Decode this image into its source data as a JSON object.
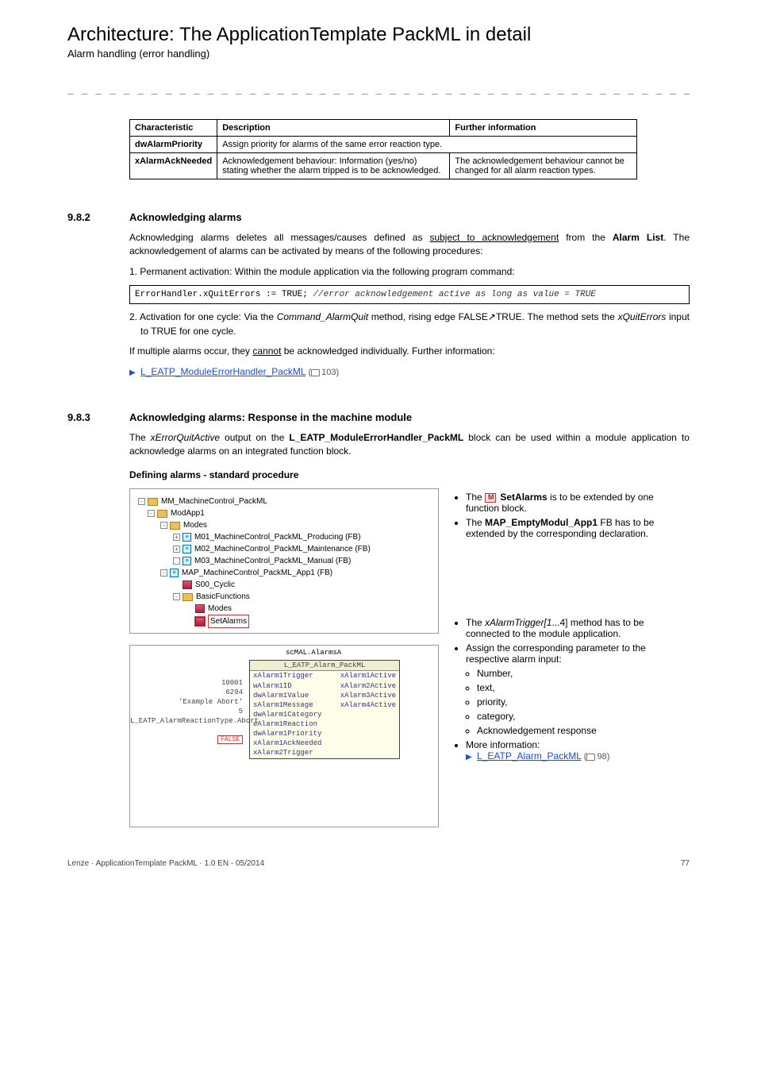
{
  "header": {
    "title": "Architecture: The ApplicationTemplate PackML in detail",
    "subtitle": "Alarm handling (error handling)",
    "dashes": "_ _ _ _ _ _ _ _ _ _ _ _ _ _ _ _ _ _ _ _ _ _ _ _ _ _ _ _ _ _ _ _ _ _ _ _ _ _ _ _ _ _ _ _ _ _ _ _ _ _ _ _ _ _ _ _ _ _ _ _ _ _ _"
  },
  "char_table": {
    "headers": {
      "c1": "Characteristic",
      "c2": "Description",
      "c3": "Further information"
    },
    "rows": [
      {
        "c1": "dwAlarmPriority",
        "c2": "Assign priority for alarms of the same error reaction type."
      },
      {
        "c1": "xAlarmAckNeeded",
        "c2": "Acknowledgement behaviour: Information (yes/no) stating whether the alarm tripped is to be acknowledged.",
        "c3": "The acknowledgement behaviour cannot be changed for all alarm reaction types."
      }
    ]
  },
  "s982": {
    "num": "9.8.2",
    "title": "Acknowledging alarms",
    "p1a": "Acknowledging alarms deletes all messages/causes defined as ",
    "p1b": "subject to acknowledgement",
    "p1c": " from the ",
    "p1d": "Alarm List",
    "p1e": ". The acknowledgement of alarms can be activated by means of the following procedures:",
    "li1": "1. Permanent activation: Within the module application via the following program command:",
    "code_a": "ErrorHandler.xQuitErrors := TRUE; ",
    "code_b": "//error acknowledgement active as long as value = TRUE",
    "li2a": "2. Activation for one cycle: Via the ",
    "li2b": "Command_AlarmQuit",
    "li2c": " method, rising edge FALSE↗TRUE. The method sets the ",
    "li2d": "xQuitErrors",
    "li2e": " input to TRUE for one cycle.",
    "p2a": "If multiple alarms occur, they ",
    "p2b": "cannot",
    "p2c": " be acknowledged individually. Further information:",
    "link": "L_EATP_ModuleErrorHandler_PackML",
    "page": " 103)"
  },
  "s983": {
    "num": "9.8.3",
    "title": "Acknowledging alarms: Response in the machine module",
    "p1a": "The ",
    "p1b": "xErrorQuitActive",
    "p1c": " output on the ",
    "p1d": "L_EATP_ModuleErrorHandler_PackML",
    "p1e": " block can be used within a module application to acknowledge alarms on an integrated function block.",
    "subhead": "Defining alarms - standard procedure"
  },
  "tree": {
    "root": "MM_MachineControl_PackML",
    "modapp1": "ModApp1",
    "modes": "Modes",
    "m01": "M01_MachineControl_PackML_Producing (FB)",
    "m02": "M02_MachineControl_PackML_Maintenance (FB)",
    "m03": "M03_MachineControl_PackML_Manual (FB)",
    "map_app1": "MAP_MachineControl_PackML_App1 (FB)",
    "s00": "S00_Cyclic",
    "basic": "BasicFunctions",
    "modes_m": "Modes",
    "setalarms": "SetAlarms"
  },
  "fbd": {
    "topname": "scMAL.AlarmsA",
    "boxtitle": "L_EATP_Alarm_PackML",
    "inputs": {
      "i1": "xAlarm1Trigger",
      "o1": "xAlarm1Active",
      "i2": "wAlarm1ID",
      "o2": "xAlarm2Active",
      "i3": "dwAlarm1Value",
      "o3": "xAlarm3Active",
      "i4": "sAlarm1Message",
      "o4": "xAlarm4Active",
      "i5": "dwAlarm1Category",
      "i6": "eAlarm1Reaction",
      "i7": "dwAlarm1Priority",
      "i8": "xAlarm1AckNeeded",
      "i9": "xAlarm2Trigger"
    },
    "labels": {
      "l2": "10001",
      "l3": "6294",
      "l4": "'Example Abort'",
      "l5": "5",
      "l6": "L_EATP_AlarmReactionType.Abort",
      "l8": "FALSE"
    }
  },
  "rightcol": {
    "b1a": "The ",
    "b1b": " SetAlarms",
    "b1c": " is to be extended by one function block.",
    "b2a": "The ",
    "b2b": "MAP_EmptyModul_App1",
    "b2c": " FB has to be extended by the corresponding declaration.",
    "b3a": "The ",
    "b3b": "xAlarmTrigger[1",
    "b3c": "...4] method has to be connected to the module application.",
    "b4": "Assign the corresponding parameter to the respective alarm input:",
    "b4a": "Number,",
    "b4b": "text,",
    "b4c": "priority,",
    "b4d": "category,",
    "b4e": "Acknowledgement response",
    "b5": "More information:",
    "b5link": "L_EATP_Alarm_PackML",
    "b5page": " 98)"
  },
  "footer": {
    "left": "Lenze · ApplicationTemplate PackML · 1.0 EN - 05/2014",
    "right": "77"
  }
}
